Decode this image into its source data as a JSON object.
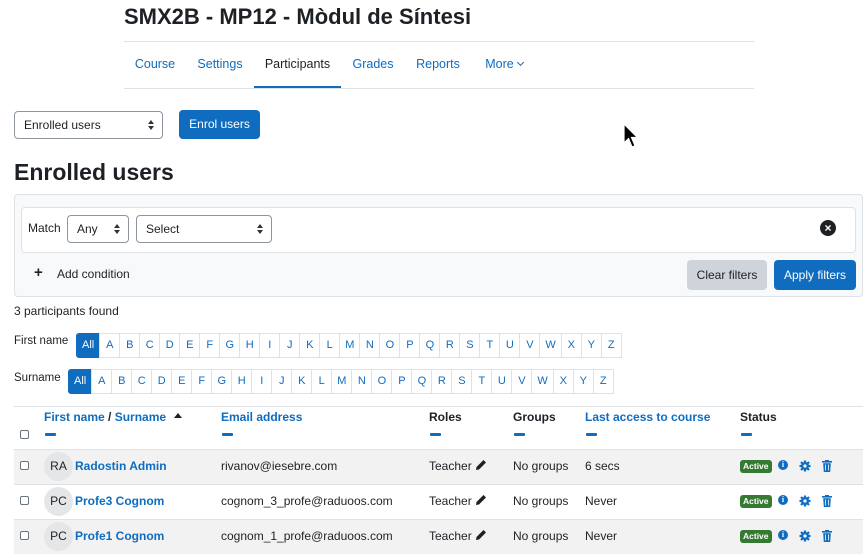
{
  "course": {
    "title": "SMX2B - MP12 - Mòdul de Síntesi"
  },
  "tabs": [
    {
      "label": "Course"
    },
    {
      "label": "Settings"
    },
    {
      "label": "Participants"
    },
    {
      "label": "Grades"
    },
    {
      "label": "Reports"
    },
    {
      "label": "More"
    }
  ],
  "toolbar": {
    "view_select": "Enrolled users",
    "enrol_button": "Enrol users"
  },
  "heading": "Enrolled users",
  "filters": {
    "match_label": "Match",
    "match_value": "Any",
    "type_select": "Select",
    "add_condition": "Add condition",
    "clear_filters": "Clear filters",
    "apply_filters": "Apply filters"
  },
  "summary": "3 participants found",
  "initials_bar": {
    "firstname_label": "First name",
    "surname_label": "Surname",
    "all_label": "All",
    "letters": [
      "A",
      "B",
      "C",
      "D",
      "E",
      "F",
      "G",
      "H",
      "I",
      "J",
      "K",
      "L",
      "M",
      "N",
      "O",
      "P",
      "Q",
      "R",
      "S",
      "T",
      "U",
      "V",
      "W",
      "X",
      "Y",
      "Z"
    ]
  },
  "table": {
    "headers": {
      "firstname": "First name",
      "separator": " / ",
      "surname": "Surname",
      "email": "Email address",
      "roles": "Roles",
      "groups": "Groups",
      "last_access": "Last access to course",
      "status": "Status"
    },
    "rows": [
      {
        "initials": "RA",
        "name": "Radostin Admin",
        "email": "rivanov@iesebre.com",
        "role": "Teacher",
        "groups": "No groups",
        "last_access": "6 secs",
        "status": "Active"
      },
      {
        "initials": "PC",
        "name": "Profe3 Cognom",
        "email": "cognom_3_profe@raduoos.com",
        "role": "Teacher",
        "groups": "No groups",
        "last_access": "Never",
        "status": "Active"
      },
      {
        "initials": "PC",
        "name": "Profe1 Cognom",
        "email": "cognom_1_profe@raduoos.com",
        "role": "Teacher",
        "groups": "No groups",
        "last_access": "Never",
        "status": "Active"
      }
    ]
  },
  "colors": {
    "primary": "#0f6cbf",
    "active_badge": "#357a32",
    "secondary_button": "#ced4da"
  }
}
